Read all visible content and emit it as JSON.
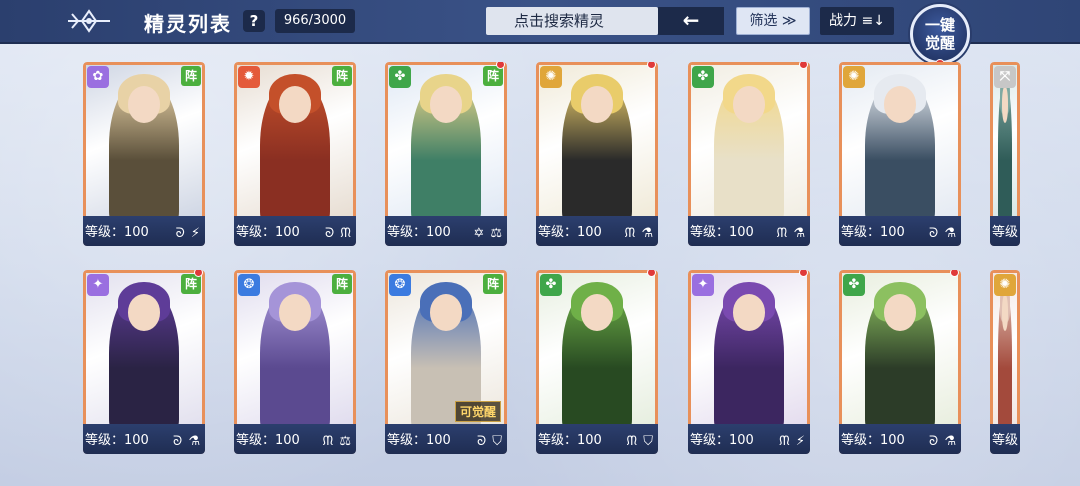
{
  "header": {
    "title": "精灵列表",
    "help": "?",
    "count": "966/3000",
    "search_placeholder": "点击搜索精灵",
    "sort_icon": "←",
    "filter_label": "筛选 ≫",
    "power_label": "战力 ≡↓",
    "awaken_line1": "一键",
    "awaken_line2": "觉醒"
  },
  "icons": {
    "logo": "logo-emblem-icon",
    "help": "question-icon",
    "sort": "arrow-left-icon",
    "filter": "chevron-double-down-icon",
    "power": "sort-descending-icon"
  },
  "cards": [
    {
      "level": "等级：100",
      "element": "✿",
      "element_color": "#9a6fe0",
      "formation": "阵",
      "attrs": "ᘐ ⚡",
      "pin": false,
      "art": [
        "#cfd6e4",
        "#5a4f3a",
        "#e8d2a6"
      ]
    },
    {
      "level": "等级：100",
      "element": "✹",
      "element_color": "#e45a3a",
      "formation": "阵",
      "attrs": "ᘐ ᙏ",
      "pin": false,
      "art": [
        "#e7ddd2",
        "#8a2f22",
        "#c4502a"
      ]
    },
    {
      "level": "等级：100",
      "element": "✤",
      "element_color": "#3fa64a",
      "formation": "阵",
      "attrs": "✡ ⚖",
      "pin": true,
      "art": [
        "#dfe8f4",
        "#3f7f66",
        "#e8d48a"
      ]
    },
    {
      "level": "等级：100",
      "element": "✺",
      "element_color": "#e0a63a",
      "formation": "",
      "attrs": "ᙏ ⚗",
      "pin": true,
      "art": [
        "#f0ead8",
        "#2a2a2a",
        "#e9cc6a"
      ]
    },
    {
      "level": "等级：100",
      "element": "✤",
      "element_color": "#3fa64a",
      "formation": "",
      "attrs": "ᙏ ⚗",
      "pin": true,
      "art": [
        "#f1ede2",
        "#e8e0c8",
        "#f2d88a"
      ]
    },
    {
      "level": "等级：100",
      "element": "✺",
      "element_color": "#e0a63a",
      "formation": "",
      "attrs": "ᘐ ⚗",
      "pin": false,
      "art": [
        "#e4eaf2",
        "#3a4e62",
        "#e6eaf0"
      ]
    },
    {
      "level": "等级",
      "element": "⤧",
      "element_color": "#c7c7c7",
      "formation": "",
      "attrs": "",
      "pin": false,
      "art": [
        "#d7e7e6",
        "#2f5c58",
        "#7fa9a2"
      ]
    },
    {
      "level": "等级：100",
      "element": "✦",
      "element_color": "#9a6fe0",
      "formation": "阵",
      "attrs": "ᘐ ⚗",
      "pin": true,
      "art": [
        "#e2e0ee",
        "#2a2344",
        "#5e3c98"
      ]
    },
    {
      "level": "等级：100",
      "element": "❂",
      "element_color": "#3b7be0",
      "formation": "阵",
      "attrs": "ᙏ ⚖",
      "pin": false,
      "art": [
        "#e0dcee",
        "#5b4a90",
        "#a594d8"
      ]
    },
    {
      "level": "等级：100",
      "element": "❂",
      "element_color": "#3b7be0",
      "formation": "阵",
      "attrs": "ᘐ ⛉",
      "pin": false,
      "art": [
        "#ece6dc",
        "#c8c0b4",
        "#4a6fb8"
      ],
      "tag": "可觉醒"
    },
    {
      "level": "等级：100",
      "element": "✤",
      "element_color": "#3fa64a",
      "formation": "",
      "attrs": "ᙏ ⛉",
      "pin": true,
      "art": [
        "#e6eedf",
        "#284a22",
        "#6fb048"
      ]
    },
    {
      "level": "等级：100",
      "element": "✦",
      "element_color": "#9a6fe0",
      "formation": "",
      "attrs": "ᙏ ⚡",
      "pin": true,
      "art": [
        "#e4dcee",
        "#3c2660",
        "#7a4ab0"
      ]
    },
    {
      "level": "等级：100",
      "element": "✤",
      "element_color": "#3fa64a",
      "formation": "",
      "attrs": "ᘐ ⚗",
      "pin": true,
      "art": [
        "#e8eede",
        "#2c3c28",
        "#8cc060"
      ]
    },
    {
      "level": "等级",
      "element": "✺",
      "element_color": "#e0a63a",
      "formation": "",
      "attrs": "",
      "pin": false,
      "art": [
        "#f2e6e2",
        "#a34a3c",
        "#e0c0b4"
      ]
    }
  ]
}
